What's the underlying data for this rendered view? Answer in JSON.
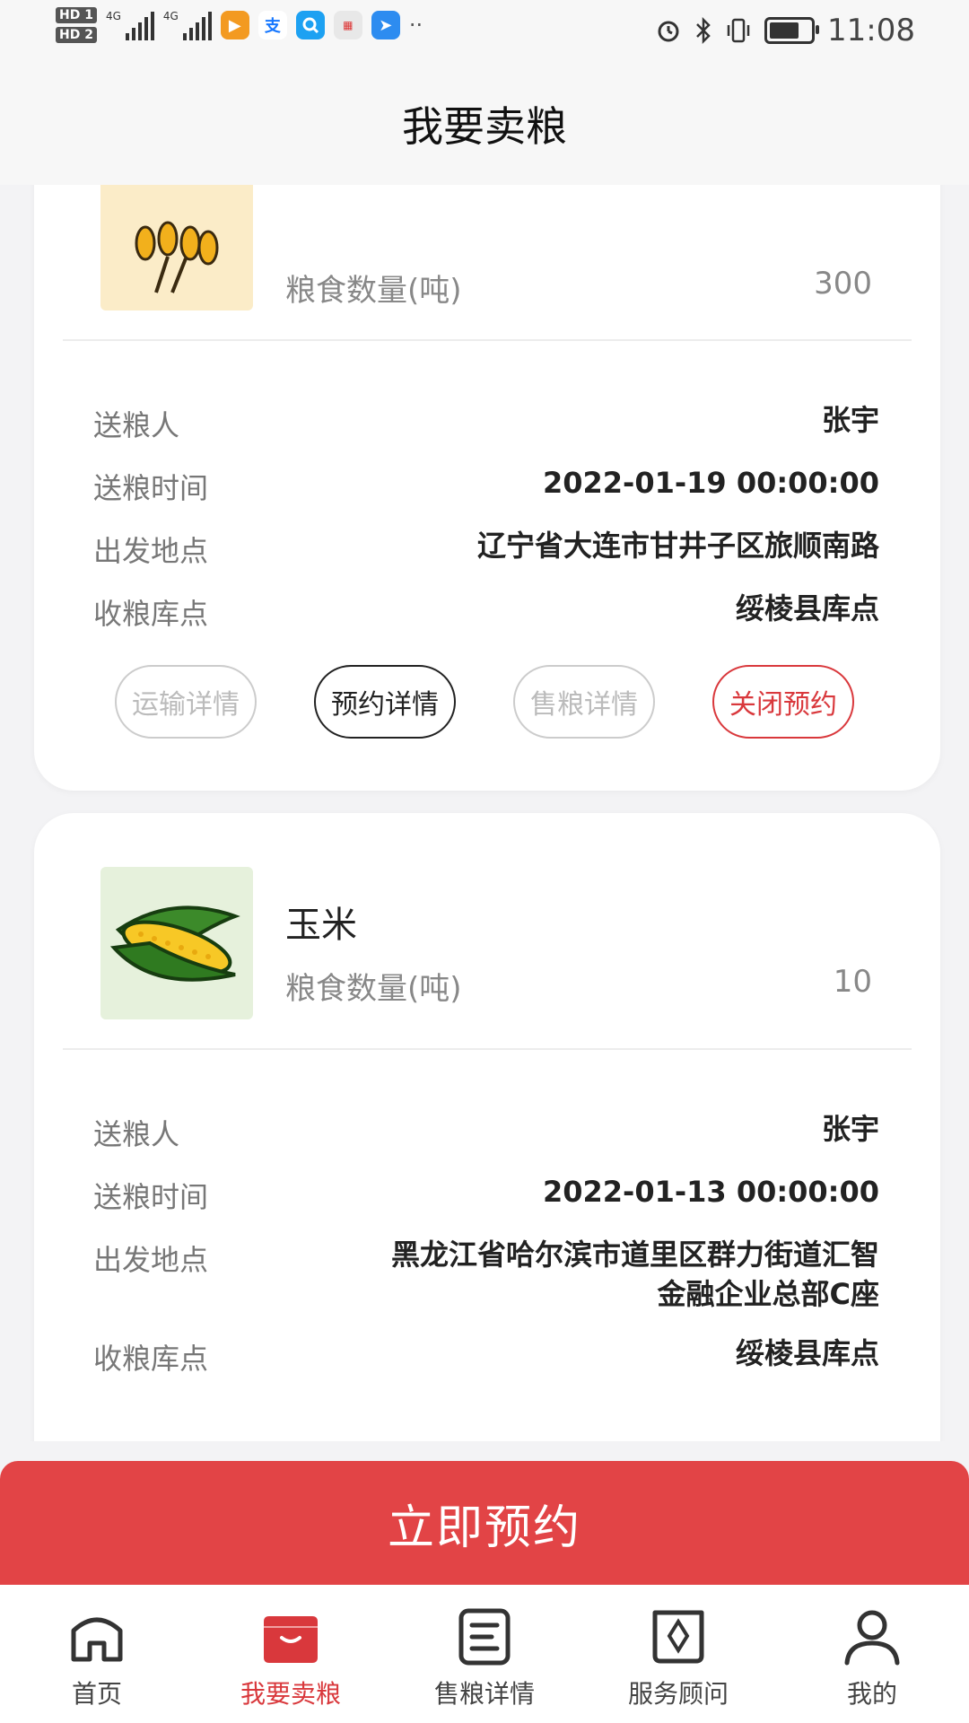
{
  "status_bar": {
    "time": "11:08",
    "sim1": "HD 1",
    "sim2": "HD 2",
    "net1": "4G",
    "net2": "4G",
    "battery_level": 0.85
  },
  "header": {
    "title": "我要卖粮"
  },
  "cards": [
    {
      "grain_name": "",
      "qty_label": "粮食数量(吨)",
      "qty_value": "300",
      "rows": [
        {
          "label": "送粮人",
          "value": "张宇"
        },
        {
          "label": "送粮时间",
          "value": "2022-01-19 00:00:00"
        },
        {
          "label": "出发地点",
          "value": "辽宁省大连市甘井子区旅顺南路"
        },
        {
          "label": "收粮库点",
          "value": "绥棱县库点"
        }
      ],
      "actions": [
        "运输详情",
        "预约详情",
        "售粮详情",
        "关闭预约"
      ]
    },
    {
      "grain_name": "玉米",
      "qty_label": "粮食数量(吨)",
      "qty_value": "10",
      "rows": [
        {
          "label": "送粮人",
          "value": "张宇"
        },
        {
          "label": "送粮时间",
          "value": "2022-01-13 00:00:00"
        },
        {
          "label": "出发地点",
          "value_line1": "黑龙江省哈尔滨市道里区群力街道汇智",
          "value_line2": "金融企业总部C座"
        },
        {
          "label": "收粮库点",
          "value": "绥棱县库点"
        }
      ]
    }
  ],
  "reserve_button": "立即预约",
  "tabs": [
    {
      "label": "首页",
      "icon": "home-icon"
    },
    {
      "label": "我要卖粮",
      "icon": "basket-icon",
      "active": true
    },
    {
      "label": "售粮详情",
      "icon": "document-icon"
    },
    {
      "label": "服务顾问",
      "icon": "advisor-icon"
    },
    {
      "label": "我的",
      "icon": "user-icon"
    }
  ],
  "colors": {
    "accent": "#d9383c",
    "button_red": "#e24446"
  }
}
